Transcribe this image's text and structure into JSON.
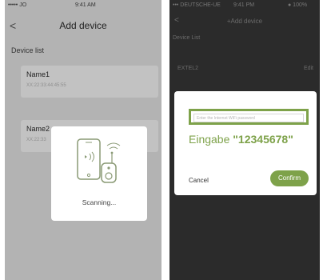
{
  "left_phone": {
    "status": {
      "carrier": "••••• JO",
      "time": "9:41 AM"
    },
    "nav": {
      "back": "<",
      "title": "Add device"
    },
    "section_label": "Device list",
    "devices": [
      {
        "name": "Name1",
        "mac": "XX:22:33:44:45:55"
      },
      {
        "name": "Name2",
        "mac": "XX:22:33"
      }
    ],
    "scanning": {
      "text": "Scanning...",
      "icon": "phone-device-scan-icon"
    }
  },
  "right_phone": {
    "status": {
      "carrier": "••• DEUTSCHE-UE",
      "time": "9:41 PM",
      "battery": "● 100%"
    },
    "nav": {
      "back": "<",
      "title": "+Add device"
    },
    "section_label": "Device List",
    "wifi_row": {
      "ssid": "EXTEL2",
      "signal": "Edit"
    },
    "dialog": {
      "password_placeholder": "Enter the Internet WiFi password",
      "hint_prefix": "Eingabe ",
      "hint_value": "\"12345678\"",
      "cancel": "Cancel",
      "confirm": "Confirm"
    }
  },
  "colors": {
    "accent": "#7ea24a",
    "left_bg": "#b3b3b3",
    "right_bg": "#2b2b2b"
  }
}
